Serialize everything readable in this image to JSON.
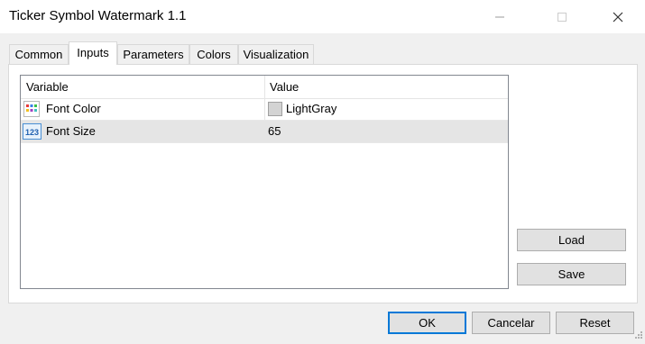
{
  "window": {
    "title": "Ticker Symbol Watermark 1.1"
  },
  "tabs": [
    {
      "label": "Common"
    },
    {
      "label": "Inputs"
    },
    {
      "label": "Parameters"
    },
    {
      "label": "Colors"
    },
    {
      "label": "Visualization"
    }
  ],
  "active_tab": "Inputs",
  "table": {
    "columns": [
      "Variable",
      "Value"
    ],
    "rows": [
      {
        "variable": "Font Color",
        "value": "LightGray",
        "icon": "color-palette-icon",
        "swatch": "#d3d3d3"
      },
      {
        "variable": "Font Size",
        "value": "65",
        "icon": "numeric-123-icon"
      }
    ]
  },
  "side_buttons": {
    "load": "Load",
    "save": "Save"
  },
  "footer_buttons": {
    "ok": "OK",
    "cancel": "Cancelar",
    "reset": "Reset"
  },
  "colors": {
    "accent": "#0078d7",
    "selected_row": "#e5e5e5"
  }
}
